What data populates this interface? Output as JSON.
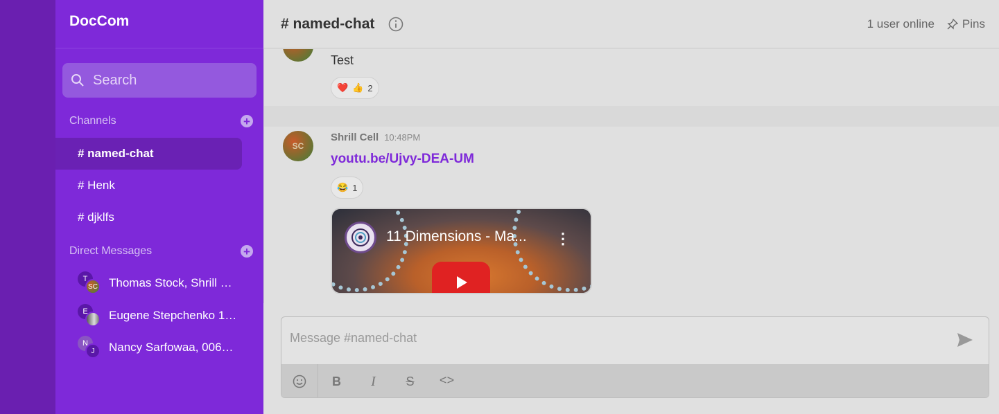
{
  "sidebar": {
    "brand": "DocCom",
    "search_placeholder": "Search",
    "channels_heading": "Channels",
    "channels": [
      {
        "label": "# named-chat",
        "active": true
      },
      {
        "label": "# Henk",
        "active": false
      },
      {
        "label": "# djklfs",
        "active": false
      }
    ],
    "dm_heading": "Direct Messages",
    "dms": [
      {
        "label": "Thomas Stock, Shrill …",
        "initial": "T",
        "second_initial": "SC"
      },
      {
        "label": "Eugene Stepchenko 1…",
        "initial": "E",
        "second_initial": ""
      },
      {
        "label": "Nancy Sarfowaa, 006…",
        "initial": "N",
        "second_initial": "J"
      }
    ]
  },
  "header": {
    "title": "# named-chat",
    "online": "1 user online",
    "pins": "Pins"
  },
  "messages": [
    {
      "avatar_initials": "SC",
      "text": "Test",
      "reactions": [
        {
          "emoji": "❤️",
          "count": ""
        },
        {
          "emoji": "👍",
          "count": "2"
        }
      ]
    },
    {
      "avatar_initials": "SC",
      "author": "Shrill Cell",
      "time": "10:48PM",
      "link": "youtu.be/Ujvy-DEA-UM",
      "reactions": [
        {
          "emoji": "😂",
          "count": "1"
        }
      ],
      "embed_title": "11 Dimensions - Ma..."
    }
  ],
  "composer": {
    "placeholder": "Message #named-chat",
    "toolbar": [
      "emoji",
      "B",
      "I",
      "S",
      "<>"
    ]
  },
  "colors": {
    "sidebar": "#7e29d9",
    "rail": "#6a1fb0",
    "link": "#7e29d9"
  }
}
